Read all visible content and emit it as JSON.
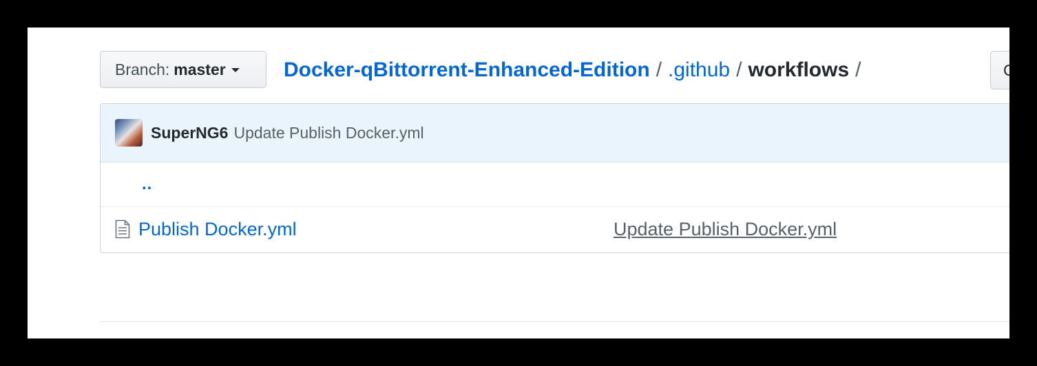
{
  "branch": {
    "prefix": "Branch:",
    "name": "master"
  },
  "breadcrumb": {
    "repo": "Docker-qBittorrent-Enhanced-Edition",
    "folder": ".github",
    "current": "workflows",
    "separator": "/"
  },
  "right_button": {
    "label": "C"
  },
  "commit": {
    "author": "SuperNG6",
    "message": "Update Publish Docker.yml"
  },
  "files": {
    "parent_link": "..",
    "rows": [
      {
        "icon": "file-text-icon",
        "name": "Publish Docker.yml",
        "message": "Update Publish Docker.yml"
      }
    ]
  },
  "colors": {
    "link": "#0366d6",
    "commit_bar_bg": "#eaf4fd",
    "text_primary": "#24292e",
    "text_secondary": "#586069"
  }
}
